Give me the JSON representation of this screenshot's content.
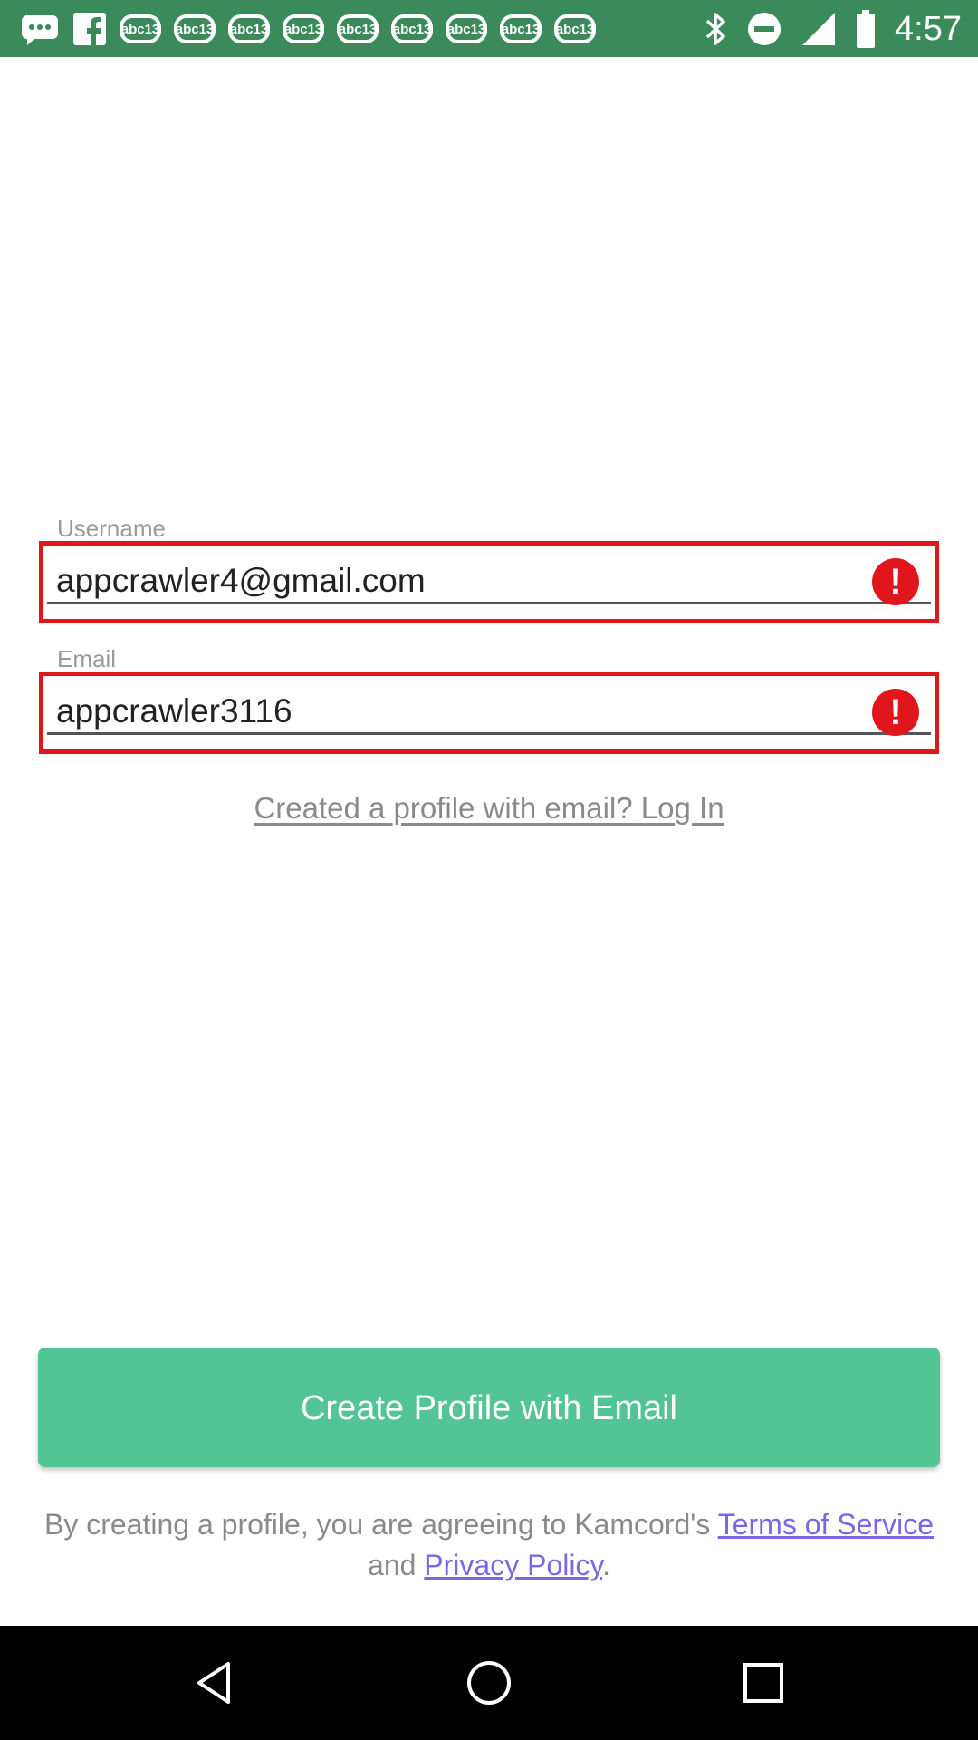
{
  "status_bar": {
    "time": "4:57",
    "notification_icons": [
      "chat-icon",
      "facebook-icon",
      "abc13-icon",
      "abc13-icon",
      "abc13-icon",
      "abc13-icon",
      "abc13-icon",
      "abc13-icon",
      "abc13-icon",
      "abc13-icon",
      "abc13-icon"
    ],
    "abc_label": "abc13",
    "system_icons": [
      "bluetooth-icon",
      "do-not-disturb-icon",
      "signal-icon",
      "battery-icon"
    ],
    "bar_color": "#3a8a5a"
  },
  "form": {
    "username": {
      "label": "Username",
      "value": "appcrawler4@gmail.com",
      "error_icon": "!"
    },
    "email": {
      "label": "Email",
      "value": "appcrawler3116",
      "error_icon": "!"
    },
    "login_link": "Created a profile with email? Log In",
    "error_color": "#e0161c"
  },
  "create_button": {
    "label": "Create Profile with Email",
    "color": "#52c495"
  },
  "terms": {
    "prefix": "By creating a profile, you are agreeing to Kamcord's ",
    "terms_link": "Terms of Service",
    "middle": " and ",
    "privacy_link": "Privacy Policy",
    "suffix": ".",
    "link_color": "#7a67e8"
  },
  "nav_bar": {
    "buttons": [
      "back-icon",
      "home-icon",
      "recents-icon"
    ]
  }
}
